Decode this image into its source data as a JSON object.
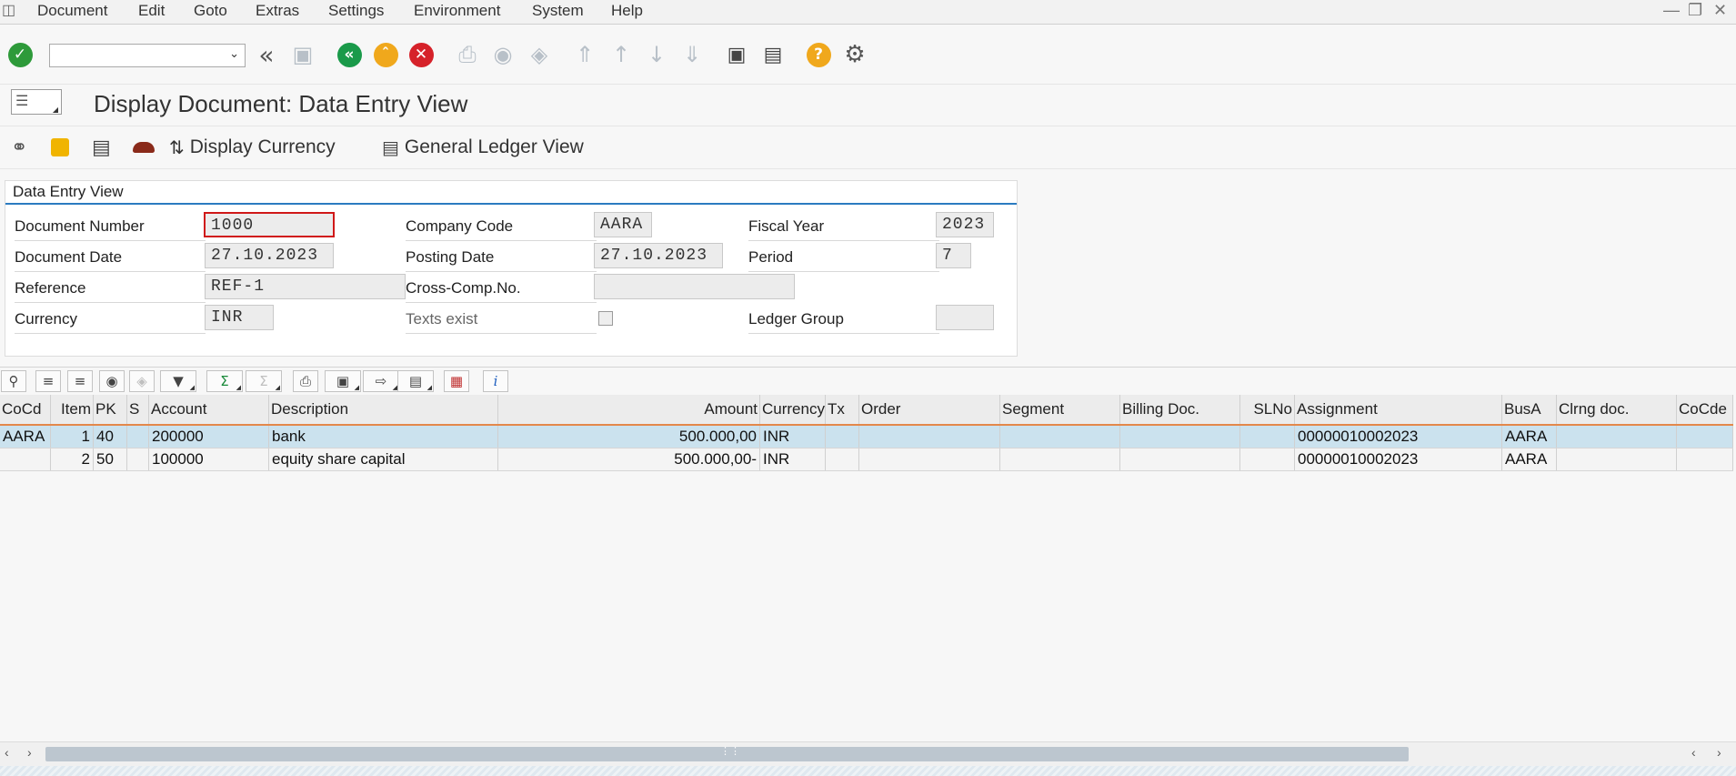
{
  "menubar": {
    "items": [
      "Document",
      "Edit",
      "Goto",
      "Extras",
      "Settings",
      "Environment",
      "System",
      "Help"
    ]
  },
  "toolbar": {
    "command_field_value": "",
    "icons": [
      "enter-icon",
      "back-double-icon",
      "save-icon",
      "back-icon",
      "exit-icon",
      "cancel-icon",
      "print-icon",
      "find-icon",
      "find-next-icon",
      "first-page-icon",
      "previous-page-icon",
      "next-page-icon",
      "last-page-icon",
      "create-session-icon",
      "generate-shortcut-icon",
      "help-icon",
      "customize-icon"
    ]
  },
  "title": "Display Document: Data Entry View",
  "app_toolbar": {
    "display_currency": "Display Currency",
    "general_ledger_view": "General Ledger View"
  },
  "header": {
    "group_title": "Data Entry View",
    "document_number_label": "Document Number",
    "document_number": "1000",
    "company_code_label": "Company Code",
    "company_code": "AARA",
    "fiscal_year_label": "Fiscal Year",
    "fiscal_year": "2023",
    "document_date_label": "Document Date",
    "document_date": "27.10.2023",
    "posting_date_label": "Posting Date",
    "posting_date": "27.10.2023",
    "period_label": "Period",
    "period": "7",
    "reference_label": "Reference",
    "reference": "REF-1",
    "cross_comp_label": "Cross-Comp.No.",
    "cross_comp": "",
    "currency_label": "Currency",
    "currency": "INR",
    "texts_exist_label": "Texts exist",
    "texts_exist": false,
    "ledger_group_label": "Ledger Group",
    "ledger_group": ""
  },
  "grid": {
    "columns": [
      "CoCd",
      "Item",
      "PK",
      "S",
      "Account",
      "Description",
      "Amount",
      "Currency",
      "Tx",
      "Order",
      "Segment",
      "Billing Doc.",
      "SLNo",
      "Assignment",
      "BusA",
      "Clrng doc.",
      "CoCde"
    ],
    "rows": [
      [
        "AARA",
        "1",
        "40",
        "",
        "200000",
        "bank",
        "500.000,00",
        "INR",
        "",
        "",
        "",
        "",
        "",
        "00000010002023",
        "AARA",
        "",
        ""
      ],
      [
        "",
        "2",
        "50",
        "",
        "100000",
        "equity share capital",
        "500.000,00-",
        "INR",
        "",
        "",
        "",
        "",
        "",
        "00000010002023",
        "AARA",
        "",
        ""
      ]
    ]
  },
  "colors": {
    "accent_blue": "#2b7bc0",
    "selected_row": "#cbe2ee",
    "header_underline": "#e3884a",
    "ok_green": "#2e9a3a",
    "cancel_red": "#d6222a",
    "help_orange": "#f0a81c"
  }
}
